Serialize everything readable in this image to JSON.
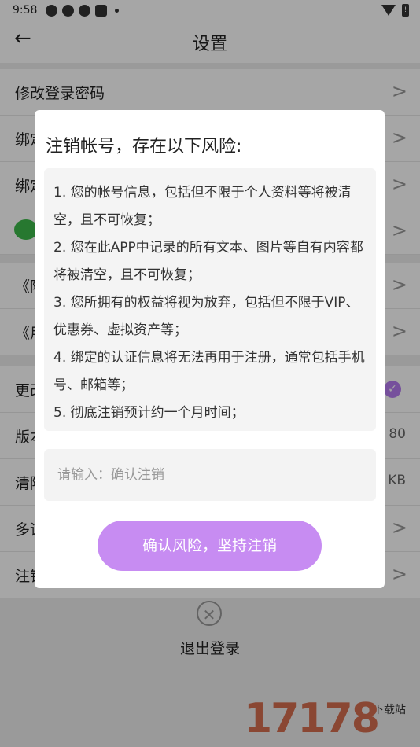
{
  "statusbar": {
    "time": "9:58"
  },
  "header": {
    "back_icon": "←",
    "title": "设置"
  },
  "rows": [
    {
      "label": "修改登录密码",
      "value": ""
    },
    {
      "label": "绑定",
      "value": ""
    },
    {
      "label": "绑定",
      "value": ""
    },
    {
      "label": "",
      "value": ""
    },
    {
      "label": "《隐",
      "value": ""
    },
    {
      "label": "《用",
      "value": ""
    },
    {
      "label": "更改",
      "value": ""
    },
    {
      "label": "版本",
      "value": "80"
    },
    {
      "label": "清除",
      "value": "KB"
    },
    {
      "label": "多语",
      "value": ""
    },
    {
      "label": "注销",
      "value": ""
    }
  ],
  "logout": {
    "label": "退出登录"
  },
  "dialog": {
    "title": "注销帐号，存在以下风险:",
    "risks": [
      "1. 您的帐号信息，包括但不限于个人资料等将被清空，且不可恢复；",
      "2. 您在此APP中记录的所有文本、图片等自有内容都将被清空，且不可恢复；",
      "3. 您所拥有的权益将视为放弃，包括但不限于VIP、优惠券、虚拟资产等；",
      "4. 绑定的认证信息将无法再用于注册，通常包括手机号、邮箱等；",
      "5. 彻底注销预计约一个月时间；"
    ],
    "input_placeholder": "请输入：确认注销",
    "confirm_label": "确认风险，坚持注销"
  },
  "watermark": {
    "text": "17178",
    "sub": "下载站"
  },
  "colors": {
    "accent": "#c78cf2",
    "wechat": "#3cb94a"
  }
}
